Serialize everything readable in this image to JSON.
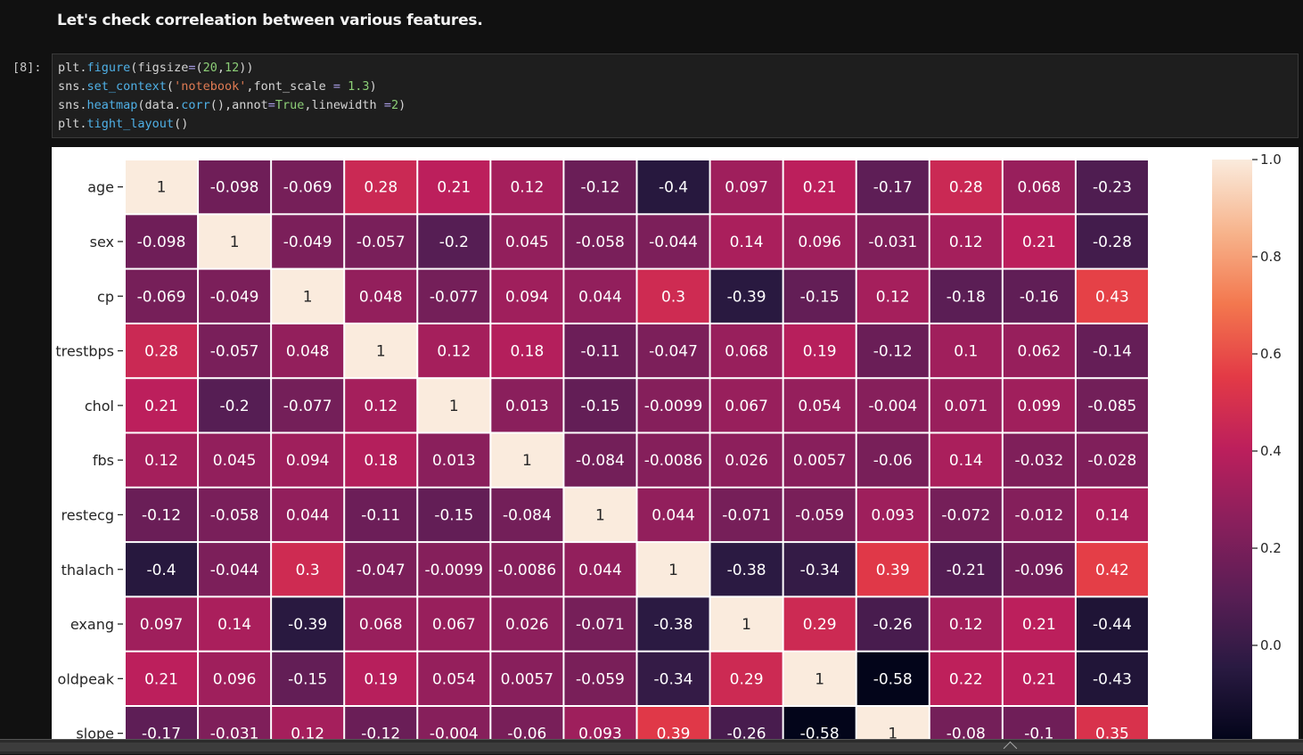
{
  "markdown": {
    "heading": "Let's check correleation between various features."
  },
  "code_cell": {
    "prompt": "[8]:",
    "lines": [
      "plt.figure(figsize=(20,12))",
      "sns.set_context('notebook',font_scale = 1.3)",
      "sns.heatmap(data.corr(),annot=True,linewidth =2)",
      "plt.tight_layout()"
    ]
  },
  "chart_data": {
    "type": "heatmap",
    "labels": [
      "age",
      "sex",
      "cp",
      "trestbps",
      "chol",
      "fbs",
      "restecg",
      "thalach",
      "exang",
      "oldpeak",
      "slope"
    ],
    "matrix": [
      [
        "1",
        "-0.098",
        "-0.069",
        "0.28",
        "0.21",
        "0.12",
        "-0.12",
        "-0.4",
        "0.097",
        "0.21",
        "-0.17",
        "0.28",
        "0.068",
        "-0.23"
      ],
      [
        "-0.098",
        "1",
        "-0.049",
        "-0.057",
        "-0.2",
        "0.045",
        "-0.058",
        "-0.044",
        "0.14",
        "0.096",
        "-0.031",
        "0.12",
        "0.21",
        "-0.28"
      ],
      [
        "-0.069",
        "-0.049",
        "1",
        "0.048",
        "-0.077",
        "0.094",
        "0.044",
        "0.3",
        "-0.39",
        "-0.15",
        "0.12",
        "-0.18",
        "-0.16",
        "0.43"
      ],
      [
        "0.28",
        "-0.057",
        "0.048",
        "1",
        "0.12",
        "0.18",
        "-0.11",
        "-0.047",
        "0.068",
        "0.19",
        "-0.12",
        "0.1",
        "0.062",
        "-0.14"
      ],
      [
        "0.21",
        "-0.2",
        "-0.077",
        "0.12",
        "1",
        "0.013",
        "-0.15",
        "-0.0099",
        "0.067",
        "0.054",
        "-0.004",
        "0.071",
        "0.099",
        "-0.085"
      ],
      [
        "0.12",
        "0.045",
        "0.094",
        "0.18",
        "0.013",
        "1",
        "-0.084",
        "-0.0086",
        "0.026",
        "0.0057",
        "-0.06",
        "0.14",
        "-0.032",
        "-0.028"
      ],
      [
        "-0.12",
        "-0.058",
        "0.044",
        "-0.11",
        "-0.15",
        "-0.084",
        "1",
        "0.044",
        "-0.071",
        "-0.059",
        "0.093",
        "-0.072",
        "-0.012",
        "0.14"
      ],
      [
        "-0.4",
        "-0.044",
        "0.3",
        "-0.047",
        "-0.0099",
        "-0.0086",
        "0.044",
        "1",
        "-0.38",
        "-0.34",
        "0.39",
        "-0.21",
        "-0.096",
        "0.42"
      ],
      [
        "0.097",
        "0.14",
        "-0.39",
        "0.068",
        "0.067",
        "0.026",
        "-0.071",
        "-0.38",
        "1",
        "0.29",
        "-0.26",
        "0.12",
        "0.21",
        "-0.44"
      ],
      [
        "0.21",
        "0.096",
        "-0.15",
        "0.19",
        "0.054",
        "0.0057",
        "-0.059",
        "-0.34",
        "0.29",
        "1",
        "-0.58",
        "0.22",
        "0.21",
        "-0.43"
      ],
      [
        "-0.17",
        "-0.031",
        "0.12",
        "-0.12",
        "-0.004",
        "-0.06",
        "0.093",
        "0.39",
        "-0.26",
        "-0.58",
        "1",
        "-0.08",
        "-0.1",
        "0.35"
      ]
    ],
    "colorbar_ticks": [
      "1.0",
      "0.8",
      "0.6",
      "0.4",
      "0.2",
      "0.0"
    ],
    "vmin": -0.58,
    "vmax": 1.0,
    "colormap_stops": [
      "#03051a",
      "#2a1a42",
      "#5a1e55",
      "#8a1f5c",
      "#bc1f5c",
      "#e33a46",
      "#f3774e",
      "#f7b48c",
      "#faebdd"
    ]
  }
}
